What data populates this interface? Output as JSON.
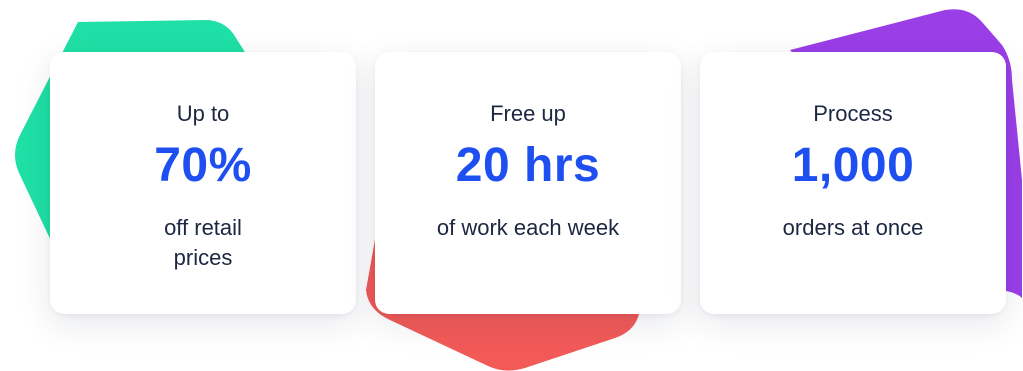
{
  "colors": {
    "accent_blue": "#1e4ff0",
    "text_dark": "#1c2742",
    "shape_green": "#1fe0a6",
    "shape_red": "#f25a58",
    "shape_purple": "#9a3ee8"
  },
  "cards": [
    {
      "prefix": "Up to",
      "stat": "70%",
      "suffix": "off retail prices"
    },
    {
      "prefix": "Free up",
      "stat": "20 hrs",
      "suffix": "of work each week"
    },
    {
      "prefix": "Process",
      "stat": "1,000",
      "suffix": "orders at once"
    }
  ]
}
